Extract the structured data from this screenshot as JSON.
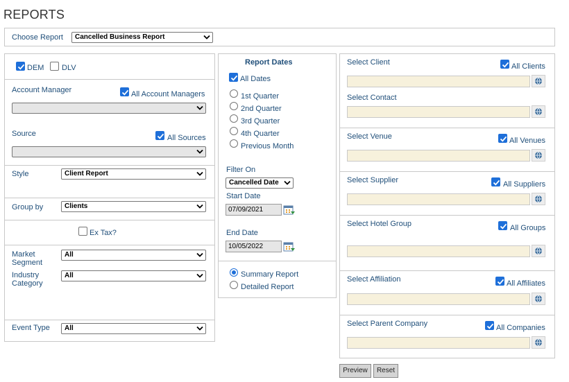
{
  "page_title": "REPORTS",
  "choose_report": {
    "label": "Choose Report",
    "value": "Cancelled Business Report"
  },
  "left": {
    "dem_label": "DEM",
    "dlv_label": "DLV",
    "account_manager_label": "Account Manager",
    "all_account_managers_label": "All Account Managers",
    "source_label": "Source",
    "all_sources_label": "All Sources",
    "style_label": "Style",
    "style_value": "Client Report",
    "group_by_label": "Group by",
    "group_by_value": "Clients",
    "ex_tax_label": "Ex Tax?",
    "market_segment_label_1": "Market",
    "market_segment_label_2": "Segment",
    "market_segment_value": "All",
    "industry_category_label_1": "Industry",
    "industry_category_label_2": "Category",
    "industry_category_value": "All",
    "event_type_label": "Event Type",
    "event_type_value": "All"
  },
  "middle": {
    "report_dates_title": "Report Dates",
    "all_dates_label": "All Dates",
    "quarters": [
      "1st Quarter",
      "2nd Quarter",
      "3rd Quarter",
      "4th Quarter",
      "Previous Month"
    ],
    "filter_on_label": "Filter On",
    "filter_on_value": "Cancelled Date",
    "start_date_label": "Start Date",
    "start_date_value": "07/09/2021",
    "end_date_label": "End Date",
    "end_date_value": "10/05/2022",
    "summary_report_label": "Summary Report",
    "detailed_report_label": "Detailed Report"
  },
  "right": {
    "select_client_label": "Select Client",
    "all_clients_label": "All Clients",
    "select_contact_label": "Select Contact",
    "select_venue_label": "Select Venue",
    "all_venues_label": "All Venues",
    "select_supplier_label": "Select Supplier",
    "all_suppliers_label": "All Suppliers",
    "select_hotel_group_label": "Select Hotel Group",
    "all_groups_label": "All Groups",
    "select_affiliation_label": "Select Affiliation",
    "all_affiliates_label": "All Affiliates",
    "select_parent_company_label": "Select Parent Company",
    "all_companies_label": "All Companies"
  },
  "buttons": {
    "preview": "Preview",
    "reset": "Reset"
  },
  "colors": {
    "label": "#1f4e79",
    "input_bg": "#f7f1dc",
    "checkbox": "#1e6fd9",
    "border": "#c8c8c8"
  }
}
